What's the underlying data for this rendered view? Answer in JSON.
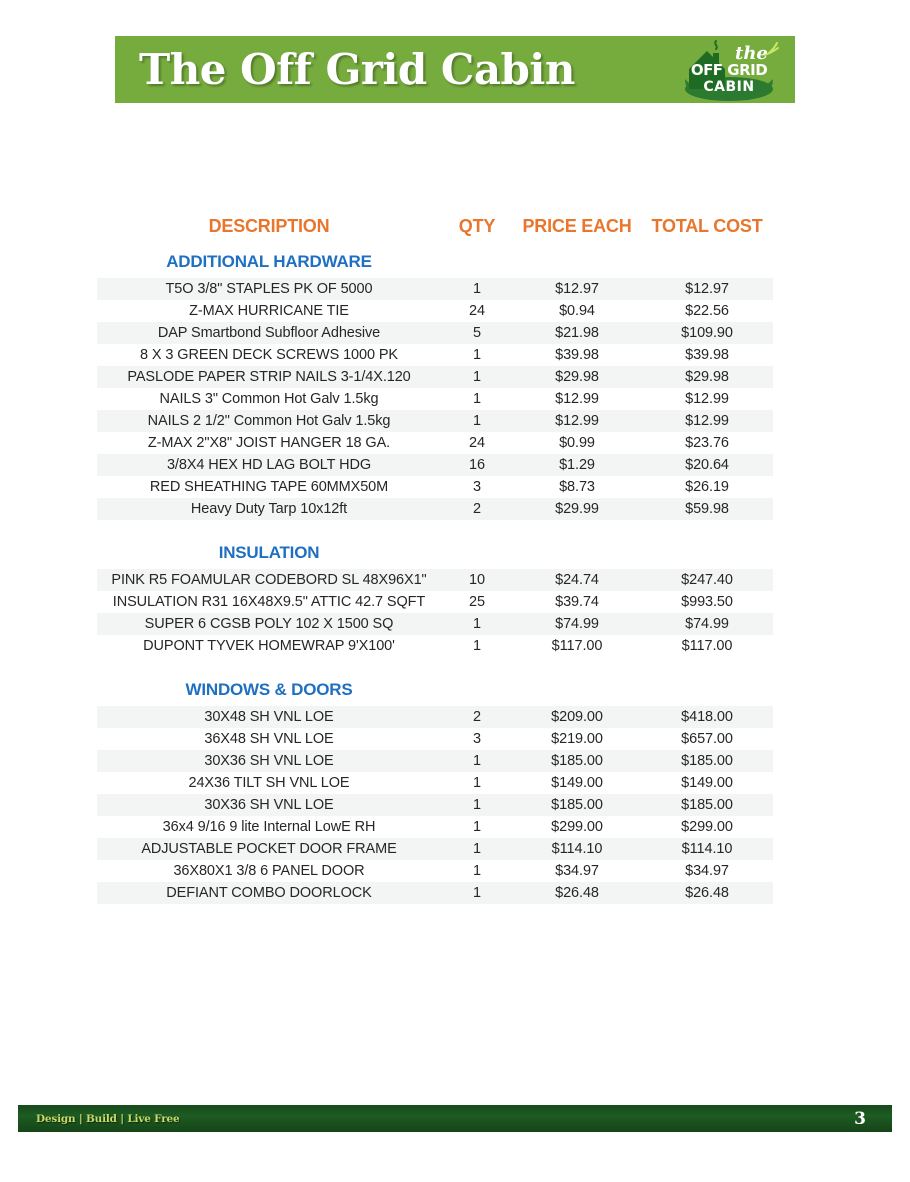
{
  "header": {
    "title": "The Off Grid Cabin",
    "banner_color": "#76ac3e",
    "logo": {
      "line1": "the",
      "line2": "OFF GRID",
      "line3": "CABIN"
    }
  },
  "table": {
    "columns": {
      "description": "DESCRIPTION",
      "qty": "QTY",
      "price_each": "PRICE EACH",
      "total_cost": "TOTAL COST"
    },
    "header_color": "#e8762c",
    "section_color": "#1f70c1",
    "sections": [
      {
        "title": "ADDITIONAL HARDWARE",
        "rows": [
          {
            "description": "T5O 3/8\" STAPLES PK OF 5000",
            "qty": "1",
            "price": "$12.97",
            "total": "$12.97"
          },
          {
            "description": "Z-MAX HURRICANE TIE",
            "qty": "24",
            "price": "$0.94",
            "total": "$22.56"
          },
          {
            "description": "DAP Smartbond Subfloor Adhesive",
            "qty": "5",
            "price": "$21.98",
            "total": "$109.90"
          },
          {
            "description": "8 X 3 GREEN DECK SCREWS 1000 PK",
            "qty": "1",
            "price": "$39.98",
            "total": "$39.98"
          },
          {
            "description": "PASLODE PAPER STRIP NAILS 3-1/4X.120",
            "qty": "1",
            "price": "$29.98",
            "total": "$29.98"
          },
          {
            "description": "NAILS 3\" Common Hot Galv 1.5kg",
            "qty": "1",
            "price": "$12.99",
            "total": "$12.99"
          },
          {
            "description": "NAILS 2 1/2\" Common Hot Galv 1.5kg",
            "qty": "1",
            "price": "$12.99",
            "total": "$12.99"
          },
          {
            "description": "Z-MAX 2\"X8\" JOIST HANGER 18 GA.",
            "qty": "24",
            "price": "$0.99",
            "total": "$23.76"
          },
          {
            "description": "3/8X4 HEX HD LAG BOLT HDG",
            "qty": "16",
            "price": "$1.29",
            "total": "$20.64"
          },
          {
            "description": "RED SHEATHING TAPE 60MMX50M",
            "qty": "3",
            "price": "$8.73",
            "total": "$26.19"
          },
          {
            "description": "Heavy Duty Tarp 10x12ft",
            "qty": "2",
            "price": "$29.99",
            "total": "$59.98"
          }
        ]
      },
      {
        "title": "INSULATION",
        "rows": [
          {
            "description": "PINK R5 FOAMULAR CODEBORD SL 48X96X1\"",
            "qty": "10",
            "price": "$24.74",
            "total": "$247.40"
          },
          {
            "description": "INSULATION R31 16X48X9.5\" ATTIC 42.7 SQFT",
            "qty": "25",
            "price": "$39.74",
            "total": "$993.50"
          },
          {
            "description": "SUPER 6 CGSB POLY 102 X 1500 SQ",
            "qty": "1",
            "price": "$74.99",
            "total": "$74.99"
          },
          {
            "description": "DUPONT TYVEK HOMEWRAP 9'X100'",
            "qty": "1",
            "price": "$117.00",
            "total": "$117.00"
          }
        ]
      },
      {
        "title": "WINDOWS & DOORS",
        "rows": [
          {
            "description": "30X48 SH VNL LOE",
            "qty": "2",
            "price": "$209.00",
            "total": "$418.00"
          },
          {
            "description": "36X48 SH VNL LOE",
            "qty": "3",
            "price": "$219.00",
            "total": "$657.00"
          },
          {
            "description": "30X36 SH VNL LOE",
            "qty": "1",
            "price": "$185.00",
            "total": "$185.00"
          },
          {
            "description": "24X36 TILT SH VNL LOE",
            "qty": "1",
            "price": "$149.00",
            "total": "$149.00"
          },
          {
            "description": "30X36 SH VNL LOE",
            "qty": "1",
            "price": "$185.00",
            "total": "$185.00"
          },
          {
            "description": "36x4 9/16 9 lite Internal LowE RH",
            "qty": "1",
            "price": "$299.00",
            "total": "$299.00"
          },
          {
            "description": "ADJUSTABLE POCKET DOOR FRAME",
            "qty": "1",
            "price": "$114.10",
            "total": "$114.10"
          },
          {
            "description": "36X80X1 3/8 6 PANEL DOOR",
            "qty": "1",
            "price": "$34.97",
            "total": "$34.97"
          },
          {
            "description": "DEFIANT COMBO DOORLOCK",
            "qty": "1",
            "price": "$26.48",
            "total": "$26.48"
          }
        ]
      }
    ]
  },
  "footer": {
    "tagline": "Design | Build | Live Free",
    "page_number": "3",
    "bar_color": "#1d5c22"
  }
}
